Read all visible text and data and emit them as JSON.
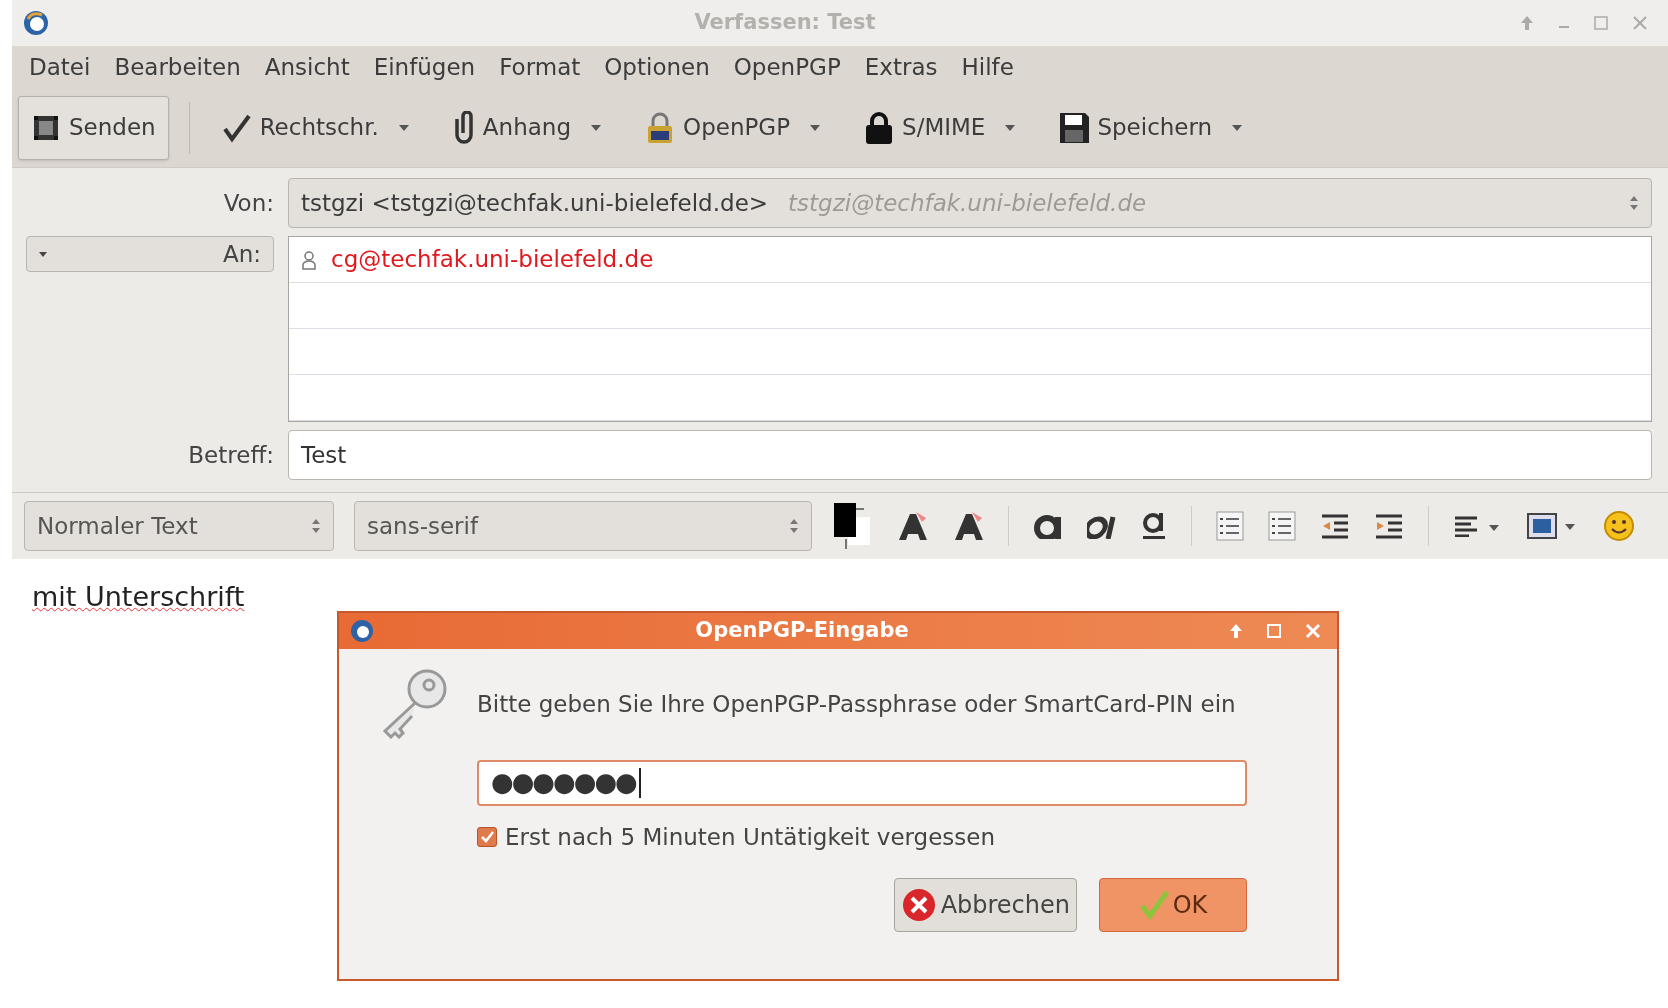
{
  "window": {
    "title": "Verfassen: Test"
  },
  "menu": [
    "Datei",
    "Bearbeiten",
    "Ansicht",
    "Einfügen",
    "Format",
    "Optionen",
    "OpenPGP",
    "Extras",
    "Hilfe"
  ],
  "toolbar": [
    {
      "label": "Senden",
      "dropdown": false
    },
    {
      "label": "Rechtschr.",
      "dropdown": true
    },
    {
      "label": "Anhang",
      "dropdown": true
    },
    {
      "label": "OpenPGP",
      "dropdown": true
    },
    {
      "label": "S/MIME",
      "dropdown": true
    },
    {
      "label": "Speichern",
      "dropdown": true
    }
  ],
  "from": {
    "label": "Von:",
    "value": "tstgzi <tstgzi@techfak.uni-bielefeld.de>",
    "hint": "tstgzi@techfak.uni-bielefeld.de"
  },
  "recipients": {
    "type_label": "An:",
    "addresses": [
      "cg@techfak.uni-bielefeld.de"
    ]
  },
  "subject": {
    "label": "Betreff:",
    "value": "Test"
  },
  "format_bar": {
    "paragraph": "Normaler Text",
    "font": "sans-serif"
  },
  "body": {
    "text": "mit Unterschrift"
  },
  "dialog": {
    "title": "OpenPGP-Eingabe",
    "prompt": "Bitte geben Sie Ihre OpenPGP-Passphrase oder SmartCard-PIN ein",
    "password": "●●●●●●●",
    "remember": {
      "label": "Erst nach 5 Minuten Untätigkeit vergessen",
      "checked": true
    },
    "buttons": [
      {
        "label": "Abbrechen",
        "kind": "cancel",
        "default": false
      },
      {
        "label": "OK",
        "kind": "ok",
        "default": true
      }
    ]
  }
}
